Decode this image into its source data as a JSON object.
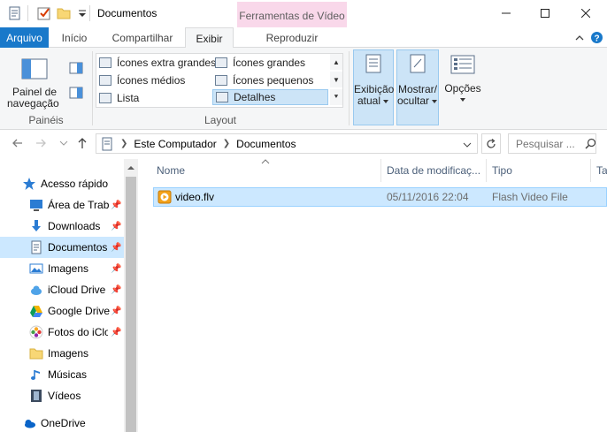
{
  "window": {
    "title": "Documentos",
    "contextual_tab_header": "Ferramentas de Vídeo"
  },
  "tabs": [
    {
      "label": "Arquivo"
    },
    {
      "label": "Início"
    },
    {
      "label": "Compartilhar"
    },
    {
      "label": "Exibir"
    },
    {
      "label": "Reproduzir"
    }
  ],
  "ribbon": {
    "panes": {
      "nav_pane_label_line1": "Painel de",
      "nav_pane_label_line2": "navegação",
      "group_label": "Painéis"
    },
    "layout": {
      "items": [
        "Ícones extra grandes",
        "Ícones grandes",
        "Ícones médios",
        "Ícones pequenos",
        "Lista",
        "Detalhes"
      ],
      "selected": "Detalhes",
      "group_label": "Layout"
    },
    "view": {
      "current_view_line1": "Exibição",
      "current_view_line2": "atual",
      "show_hide_line1": "Mostrar/",
      "show_hide_line2": "ocultar",
      "options": "Opções"
    }
  },
  "address": {
    "crumbs": [
      "Este Computador",
      "Documentos"
    ],
    "search_placeholder": "Pesquisar ..."
  },
  "nav": {
    "items": [
      {
        "label": "Acesso rápido",
        "icon": "star-icon",
        "pinned": false
      },
      {
        "label": "Área de Trabalho",
        "icon": "desktop-icon",
        "pinned": true
      },
      {
        "label": "Downloads",
        "icon": "download-icon",
        "pinned": true
      },
      {
        "label": "Documentos",
        "icon": "document-icon",
        "pinned": true,
        "selected": true
      },
      {
        "label": "Imagens",
        "icon": "pictures-icon",
        "pinned": true
      },
      {
        "label": "iCloud Drive",
        "icon": "icloud-icon",
        "pinned": true
      },
      {
        "label": "Google Drive",
        "icon": "google-drive-icon",
        "pinned": true
      },
      {
        "label": "Fotos do iCloud",
        "icon": "photos-icon",
        "pinned": true
      },
      {
        "label": "Imagens",
        "icon": "folder-icon",
        "pinned": false
      },
      {
        "label": "Músicas",
        "icon": "music-icon",
        "pinned": false
      },
      {
        "label": "Vídeos",
        "icon": "videos-icon",
        "pinned": false
      },
      {
        "label": "OneDrive",
        "icon": "onedrive-icon",
        "pinned": false
      }
    ]
  },
  "columns": [
    "Nome",
    "Data de modificaç...",
    "Tipo",
    "Ta"
  ],
  "files": [
    {
      "name": "video.flv",
      "modified": "05/11/2016 22:04",
      "type": "Flash Video File"
    }
  ],
  "colors": {
    "accent": "#1979ca",
    "selection": "#cce8ff",
    "contextual_tab": "#f9d8ea"
  }
}
